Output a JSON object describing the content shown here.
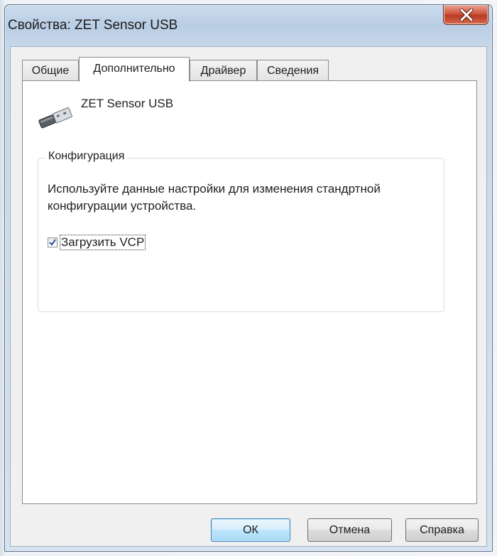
{
  "window": {
    "title": "Свойства: ZET Sensor USB",
    "close_icon": "close-icon"
  },
  "tabs": [
    {
      "label": "Общие",
      "active": false
    },
    {
      "label": "Дополнительно",
      "active": true
    },
    {
      "label": "Драйвер",
      "active": false
    },
    {
      "label": "Сведения",
      "active": false
    }
  ],
  "device": {
    "icon": "usb-connector-icon",
    "name": "ZET Sensor USB"
  },
  "configuration": {
    "legend": "Конфигурация",
    "description": "Используйте данные настройки для изменения стандртной конфигурации устройства.",
    "checkbox_label": "Загрузить VCP",
    "checkbox_checked": true
  },
  "buttons": {
    "ok": "ОК",
    "cancel": "Отмена",
    "help": "Справка"
  },
  "colors": {
    "close_button": "#c9492f",
    "default_button_border": "#3c7fb1",
    "titlebar": "#b9cde4"
  }
}
